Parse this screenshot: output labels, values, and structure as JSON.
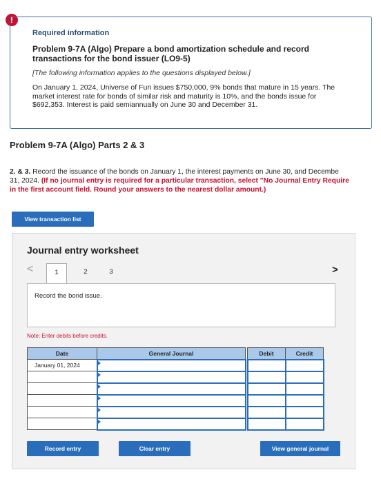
{
  "info": {
    "alert_symbol": "!",
    "required_label": "Required information",
    "problem_title": "Problem 9-7A (Algo) Prepare a bond amortization schedule and record transactions for the bond issuer (LO9-5)",
    "applies_note": "[The following information applies to the questions displayed below.]",
    "body_text": "On January 1, 2024, Universe of Fun issues $750,000, 9% bonds that mature in 15 years. The market interest rate for bonds of similar risk and maturity is 10%, and the bonds issue for $692,353. Interest is paid semiannually on June 30 and December 31."
  },
  "part_title": "Problem 9-7A (Algo) Parts 2 & 3",
  "instructions": {
    "lead": "2. & 3.",
    "line1_rest": " Record the issuance of the bonds on January 1, the interest payments on June 30, and Decembe",
    "line2_plain": "31, 2024. ",
    "line2_red": "(If no journal entry is required for a particular transaction, select \"No Journal Entry Require",
    "line3_red": "in the first account field. Round your answers to the nearest dollar amount.)"
  },
  "buttons": {
    "view_transaction_list": "View transaction list",
    "record_entry": "Record entry",
    "clear_entry": "Clear entry",
    "view_general_journal": "View general journal"
  },
  "worksheet": {
    "title": "Journal entry worksheet",
    "prev_symbol": "<",
    "next_symbol": ">",
    "tabs": [
      "1",
      "2",
      "3"
    ],
    "active_tab": 0,
    "description": "Record the bond issue.",
    "note": "Note: Enter debits before credits.",
    "columns": {
      "date": "Date",
      "general_journal": "General Journal",
      "debit": "Debit",
      "credit": "Credit"
    },
    "rows": [
      {
        "date": "January 01, 2024",
        "account": "",
        "debit": "",
        "credit": ""
      },
      {
        "date": "",
        "account": "",
        "debit": "",
        "credit": ""
      },
      {
        "date": "",
        "account": "",
        "debit": "",
        "credit": ""
      },
      {
        "date": "",
        "account": "",
        "debit": "",
        "credit": ""
      },
      {
        "date": "",
        "account": "",
        "debit": "",
        "credit": ""
      },
      {
        "date": "",
        "account": "",
        "debit": "",
        "credit": ""
      }
    ]
  }
}
